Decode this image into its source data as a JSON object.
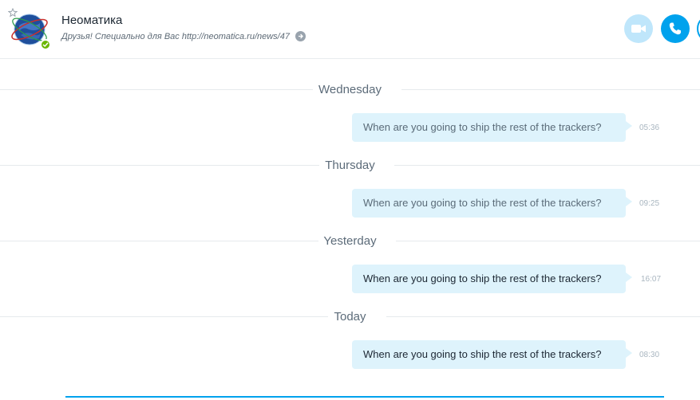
{
  "header": {
    "contact_name": "Неоматика",
    "mood_message": "Друзья! Специально для Вас http://neomatica.ru/news/47",
    "presence": "online",
    "icons": {
      "favorite": "star-outline-icon",
      "video": "video-camera-icon",
      "audio": "phone-icon",
      "mood_link": "arrow-right-icon",
      "presence": "checkmark-icon"
    },
    "colors": {
      "accent": "#00a2ed",
      "video_button": "#bfe6fb",
      "presence_online": "#6bb700",
      "bubble": "#def3fc"
    }
  },
  "conversation": [
    {
      "day": "Wednesday",
      "text": "When are you going to ship the rest of the trackers?",
      "time": "05:36"
    },
    {
      "day": "Thursday",
      "text": "When are you going to ship the rest of the trackers?",
      "time": "09:25"
    },
    {
      "day": "Yesterday",
      "text": "When are you going to ship the rest of the trackers?",
      "time": "16:07"
    },
    {
      "day": "Today",
      "text": "When are you going to ship the rest of the trackers?",
      "time": "08:30"
    }
  ]
}
